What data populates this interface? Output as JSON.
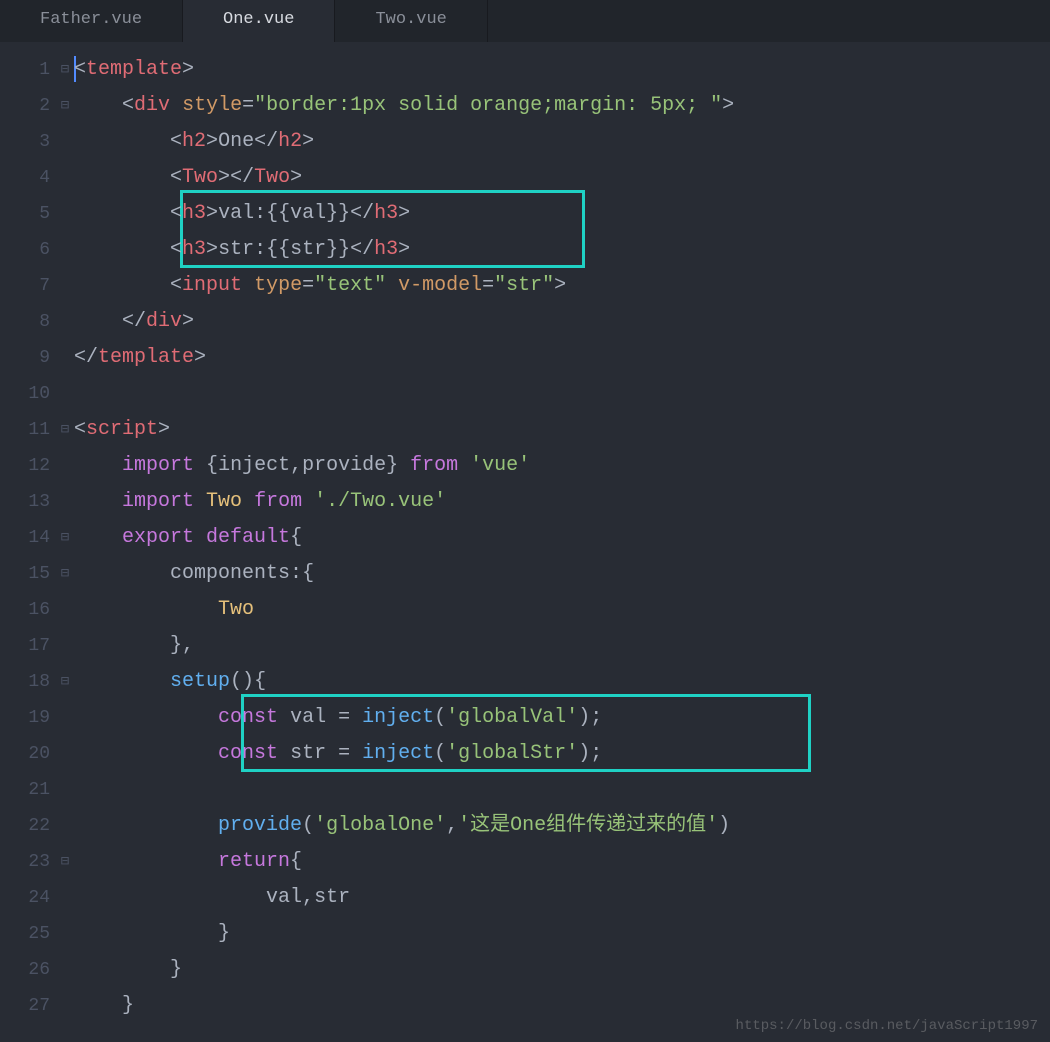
{
  "tabs": [
    {
      "label": "Father.vue",
      "active": false
    },
    {
      "label": "One.vue",
      "active": true
    },
    {
      "label": "Two.vue",
      "active": false
    }
  ],
  "lineNumbers": [
    "1",
    "2",
    "3",
    "4",
    "5",
    "6",
    "7",
    "8",
    "9",
    "10",
    "11",
    "12",
    "13",
    "14",
    "15",
    "16",
    "17",
    "18",
    "19",
    "20",
    "21",
    "22",
    "23",
    "24",
    "25",
    "26",
    "27"
  ],
  "fold": [
    "⊟",
    "⊟",
    "",
    "",
    "",
    "",
    "",
    "",
    "",
    "",
    "⊟",
    "",
    "",
    "⊟",
    "⊟",
    "",
    "",
    "⊟",
    "",
    "",
    "",
    "",
    "⊟",
    "",
    "",
    "",
    ""
  ],
  "code": {
    "l1": {
      "p1": "<",
      "tag": "template",
      "p2": ">"
    },
    "l2": {
      "p1": "<",
      "tag": "div",
      "sp": " ",
      "attr": "style",
      "eq": "=",
      "str": "\"border:1px solid orange;margin: 5px; \"",
      "p2": ">"
    },
    "l3": {
      "p1": "<",
      "tag": "h2",
      "p2": ">",
      "text": "One",
      "p3": "</",
      "p4": ">"
    },
    "l4": {
      "p1": "<",
      "tag": "Two",
      "p2": ">",
      "p3": "</",
      "p4": ">"
    },
    "l5": {
      "p1": "<",
      "tag": "h3",
      "p2": ">",
      "text": "val:{{val}}",
      "p3": "</",
      "p4": ">"
    },
    "l6": {
      "p1": "<",
      "tag": "h3",
      "p2": ">",
      "text": "str:{{str}}",
      "p3": "</",
      "p4": ">"
    },
    "l7": {
      "p1": "<",
      "tag": "input",
      "sp": " ",
      "attr1": "type",
      "eq": "=",
      "str1": "\"text\"",
      "sp2": " ",
      "attr2": "v-model",
      "str2": "\"str\"",
      "p2": ">"
    },
    "l8": {
      "p1": "</",
      "tag": "div",
      "p2": ">"
    },
    "l9": {
      "p1": "</",
      "tag": "template",
      "p2": ">"
    },
    "l11": {
      "p1": "<",
      "tag": "script",
      "p2": ">"
    },
    "l12": {
      "kw": "import",
      "sp": " ",
      "p1": "{",
      "v1": "inject",
      "c": ",",
      "v2": "provide",
      "p2": "}",
      "sp2": " ",
      "kw2": "from",
      "sp3": " ",
      "str": "'vue'"
    },
    "l13": {
      "kw": "import",
      "sp": " ",
      "name": "Two",
      "sp2": " ",
      "kw2": "from",
      "sp3": " ",
      "str": "'./Two.vue'"
    },
    "l14": {
      "kw": "export",
      "sp": " ",
      "kw2": "default",
      "p1": "{"
    },
    "l15": {
      "name": "components",
      "p1": ":",
      "p2": "{"
    },
    "l16": {
      "name": "Two"
    },
    "l17": {
      "p1": "}",
      "c": ","
    },
    "l18": {
      "fn": "setup",
      "p1": "(",
      "p2": ")",
      "p3": "{"
    },
    "l19": {
      "kw": "const",
      "sp": " ",
      "var": "val",
      "sp2": " ",
      "eq": "=",
      "sp3": " ",
      "fn": "inject",
      "p1": "(",
      "str": "'globalVal'",
      "p2": ")",
      "sc": ";"
    },
    "l20": {
      "kw": "const",
      "sp": " ",
      "var": "str",
      "sp2": " ",
      "eq": "=",
      "sp3": " ",
      "fn": "inject",
      "p1": "(",
      "str": "'globalStr'",
      "p2": ")",
      "sc": ";"
    },
    "l22": {
      "fn": "provide",
      "p1": "(",
      "str1": "'globalOne'",
      "c": ",",
      "str2": "'这是One组件传递过来的值'",
      "p2": ")"
    },
    "l23": {
      "kw": "return",
      "p1": "{"
    },
    "l24": {
      "v1": "val",
      "c": ",",
      "v2": "str"
    },
    "l25": {
      "p1": "}"
    },
    "l26": {
      "p1": "}"
    },
    "l27": {
      "p1": "}"
    }
  },
  "watermark": "https://blog.csdn.net/javaScript1997"
}
